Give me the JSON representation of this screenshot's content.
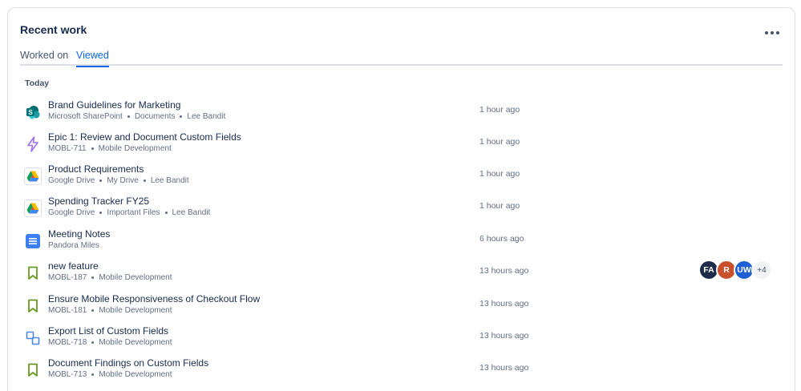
{
  "card": {
    "title": "Recent work",
    "tabs": [
      "Worked on",
      "Viewed"
    ],
    "section_label": "Today"
  },
  "rows": [
    {
      "title": "Brand Guidelines for Marketing",
      "meta": [
        "Microsoft SharePoint",
        "Documents",
        "Lee Bandit"
      ],
      "time": "1 hour ago",
      "icon": "sharepoint-icon"
    },
    {
      "title": "Epic 1: Review and Document Custom Fields",
      "meta": [
        "MOBL-711",
        "Mobile Development"
      ],
      "time": "1 hour ago",
      "icon": "epic-lightning-icon"
    },
    {
      "title": "Product Requirements",
      "meta": [
        "Google Drive",
        "My Drive",
        "Lee Bandit"
      ],
      "time": "1 hour ago",
      "icon": "google-drive-icon"
    },
    {
      "title": "Spending Tracker FY25",
      "meta": [
        "Google Drive",
        "Important Files",
        "Lee Bandit"
      ],
      "time": "1 hour ago",
      "icon": "google-drive-icon"
    },
    {
      "title": "Meeting Notes",
      "meta": [
        "Pandora Miles"
      ],
      "time": "6 hours ago",
      "icon": "document-icon"
    },
    {
      "title": "new feature",
      "meta": [
        "MOBL-187",
        "Mobile Development"
      ],
      "time": "13 hours ago",
      "icon": "story-bookmark-icon"
    },
    {
      "title": "Ensure Mobile Responsiveness of Checkout Flow",
      "meta": [
        "MOBL-181",
        "Mobile Development"
      ],
      "time": "13 hours ago",
      "icon": "story-bookmark-icon"
    },
    {
      "title": "Export List of Custom Fields",
      "meta": [
        "MOBL-718",
        "Mobile Development"
      ],
      "time": "13 hours ago",
      "icon": "subtask-icon"
    },
    {
      "title": "Document Findings on Custom Fields",
      "meta": [
        "MOBL-713",
        "Mobile Development"
      ],
      "time": "13 hours ago",
      "icon": "story-bookmark-icon"
    }
  ],
  "avatars": [
    {
      "initials": "FA",
      "color": "#1d2b4a"
    },
    {
      "initials": "R",
      "color": "#c9502a"
    },
    {
      "initials": "UW",
      "color": "#1f5fd6"
    },
    {
      "initials": "+4",
      "color": "#f1f2f4"
    }
  ],
  "colors": {
    "accent": "#0c66e4",
    "text": "#172b4d",
    "subtle": "#626f86",
    "story_green": "#6a9a23",
    "epic_purple": "#9f6ff0",
    "subtask_blue": "#4c86e8"
  }
}
